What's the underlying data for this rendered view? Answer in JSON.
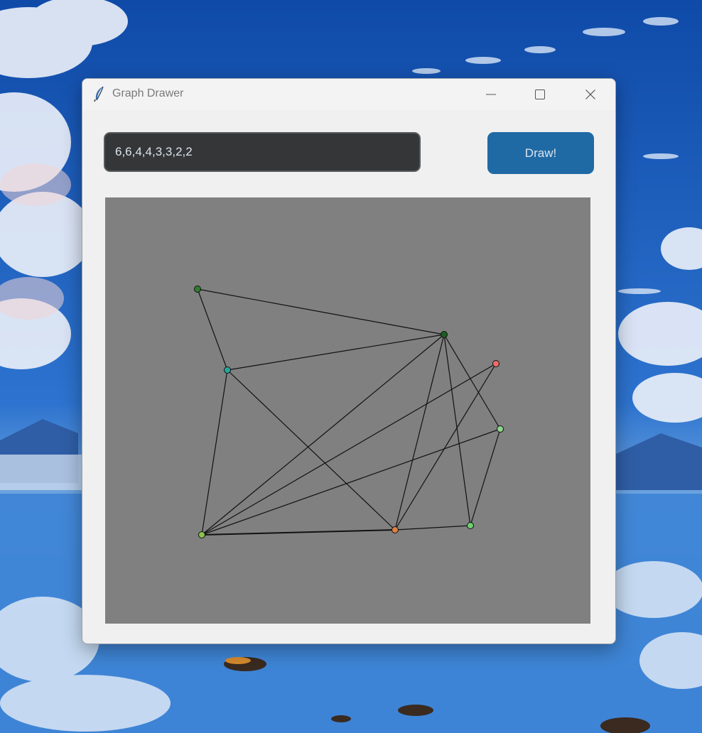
{
  "window": {
    "title": "Graph Drawer",
    "controls": {
      "minimize_icon": "minimize-icon",
      "maximize_icon": "maximize-icon",
      "close_icon": "close-icon"
    }
  },
  "input": {
    "value": "6,6,4,4,3,3,2,2"
  },
  "draw_button": {
    "label": "Draw!"
  },
  "colors": {
    "window_bg": "#f0f0f0",
    "input_bg": "#343638",
    "button_bg": "#1f6aa5",
    "canvas_bg": "#808080",
    "edge": "#111111"
  },
  "graph": {
    "nodes": [
      {
        "id": "a",
        "color": "#2e7d32"
      },
      {
        "id": "b",
        "color": "#1b5e20"
      },
      {
        "id": "c",
        "color": "#26a69a"
      },
      {
        "id": "d",
        "color": "#ef6c6c"
      },
      {
        "id": "e",
        "color": "#8fd48f"
      },
      {
        "id": "f",
        "color": "#8bc34a"
      },
      {
        "id": "g",
        "color": "#e08040"
      },
      {
        "id": "h",
        "color": "#6fcf6f"
      }
    ],
    "edges": [
      [
        "a",
        "b"
      ],
      [
        "a",
        "c"
      ],
      [
        "c",
        "b"
      ],
      [
        "c",
        "f"
      ],
      [
        "c",
        "g"
      ],
      [
        "b",
        "f"
      ],
      [
        "b",
        "g"
      ],
      [
        "b",
        "h"
      ],
      [
        "b",
        "e"
      ],
      [
        "d",
        "f"
      ],
      [
        "d",
        "g"
      ],
      [
        "e",
        "f"
      ],
      [
        "e",
        "h"
      ],
      [
        "f",
        "g"
      ],
      [
        "g",
        "h"
      ]
    ]
  }
}
